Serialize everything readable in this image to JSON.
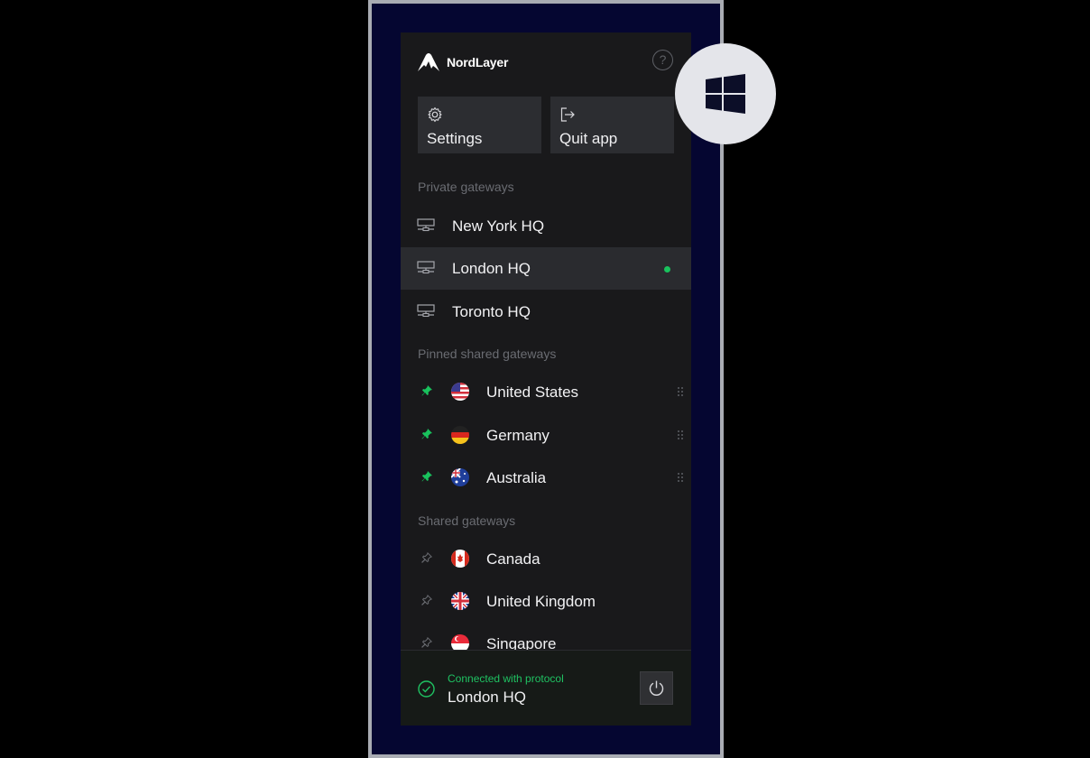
{
  "app": {
    "brand": "NordLayer"
  },
  "header": {
    "help_icon": "question-circle-icon"
  },
  "actions": [
    {
      "label": "Settings",
      "icon": "gear-icon"
    },
    {
      "label": "Quit app",
      "icon": "exit-icon"
    }
  ],
  "sections": {
    "private": "Private gateways",
    "pinned": "Pinned shared gateways",
    "shared": "Shared gateways"
  },
  "private_gateways": [
    {
      "name": "New York HQ",
      "active": false
    },
    {
      "name": "London HQ",
      "active": true
    },
    {
      "name": "Toronto HQ",
      "active": false
    }
  ],
  "pinned_gateways": [
    {
      "name": "United States",
      "flag": "us-flag-icon"
    },
    {
      "name": "Germany",
      "flag": "de-flag-icon"
    },
    {
      "name": "Australia",
      "flag": "au-flag-icon"
    }
  ],
  "shared_gateways": [
    {
      "name": "Canada",
      "flag": "ca-flag-icon"
    },
    {
      "name": "United Kingdom",
      "flag": "gb-flag-icon"
    },
    {
      "name": "Singapore",
      "flag": "sg-flag-icon"
    }
  ],
  "connection": {
    "status": "Connected with protocol",
    "gateway": "London HQ"
  },
  "colors": {
    "accent": "#1fc262",
    "panel": "#19191b",
    "tile": "#2c2d31",
    "frame": "#050631"
  },
  "badge": {
    "icon": "windows-logo-icon"
  }
}
